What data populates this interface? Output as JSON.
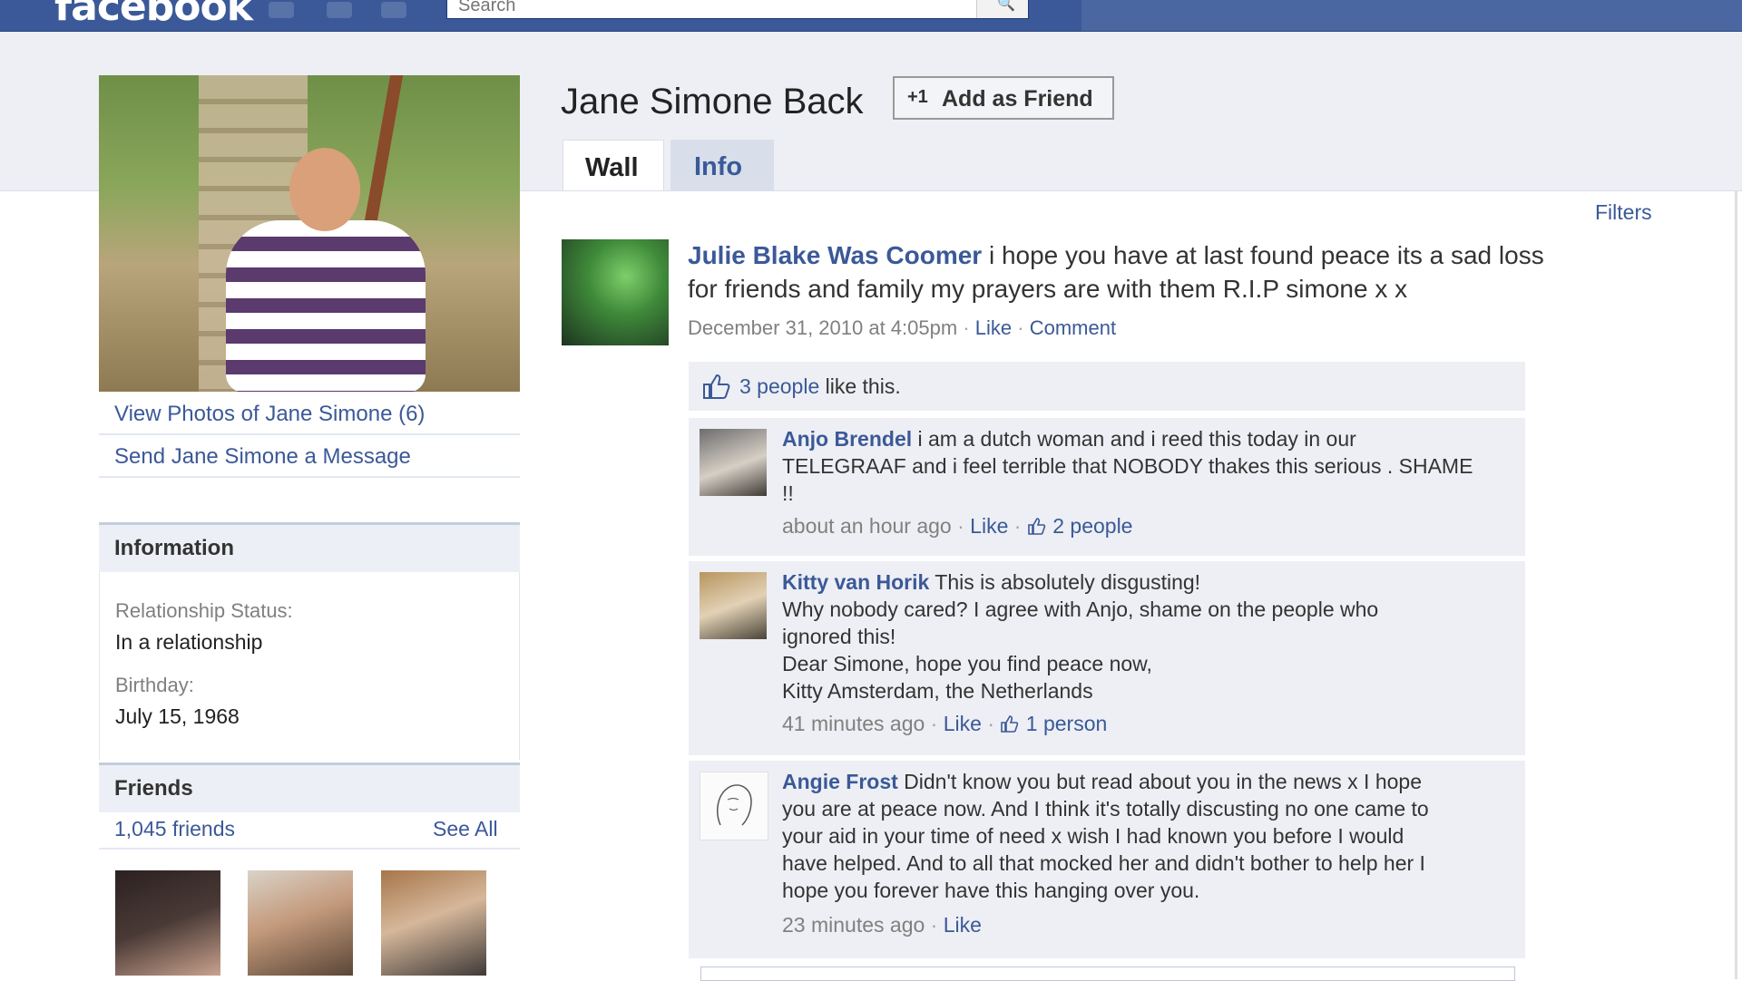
{
  "topbar": {
    "logo": "facebook",
    "search_placeholder": "Search"
  },
  "profile": {
    "name": "Jane Simone Back",
    "add_friend_label": "Add as Friend",
    "add_friend_icon": "+1",
    "tabs": [
      {
        "label": "Wall",
        "active": true
      },
      {
        "label": "Info",
        "active": false
      }
    ],
    "filters_label": "Filters"
  },
  "sidebar": {
    "links": [
      {
        "label": "View Photos of Jane Simone (6)"
      },
      {
        "label": "Send Jane Simone a Message"
      }
    ],
    "information": {
      "heading": "Information",
      "fields": [
        {
          "label": "Relationship Status:",
          "value": "In a relationship"
        },
        {
          "label": "Birthday:",
          "value": "July 15, 1968"
        }
      ]
    },
    "friends": {
      "heading": "Friends",
      "count": "1,045 friends",
      "see_all": "See All"
    }
  },
  "post": {
    "author": "Julie Blake Was Coomer",
    "text_line_1": " i hope you have at last found peace its a sad loss",
    "text_line_2": "for friends and family my prayers are with them R.I.P simone x x",
    "timestamp": "December 31, 2010 at 4:05pm",
    "like_label": "Like",
    "comment_label": "Comment",
    "likes_people": "3 people",
    "likes_suffix": " like this.",
    "comments": [
      {
        "author": "Anjo Brendel",
        "lines": [
          " i am a dutch woman and i reed this today in our",
          "TELEGRAAF and i feel terrible that NOBODY thakes this serious . SHAME",
          "!!"
        ],
        "time": "about an hour ago",
        "like_label": "Like",
        "likes": "2 people"
      },
      {
        "author": "Kitty van Horik",
        "lines": [
          " This is absolutely disgusting!",
          "Why nobody cared? I agree with Anjo, shame on the people who",
          "ignored this!",
          "Dear Simone, hope you find peace now,",
          "Kitty Amsterdam, the Netherlands"
        ],
        "time": "41 minutes ago",
        "like_label": "Like",
        "likes": "1 person"
      },
      {
        "author": "Angie Frost",
        "lines": [
          " Didn't know you but read about you in the news x I hope",
          "you are at peace now. And I think it's totally discusting no one came to",
          "your aid in your time of need x wish I had known you before I would",
          "have helped. And to all that mocked her and didn't bother to help her I",
          "hope you forever have this hanging over you."
        ],
        "time": "23 minutes ago",
        "like_label": "Like"
      }
    ]
  },
  "colors": {
    "brand_blue": "#3b5998",
    "header_band": "#edeff4",
    "comment_bg": "#edeff4"
  }
}
